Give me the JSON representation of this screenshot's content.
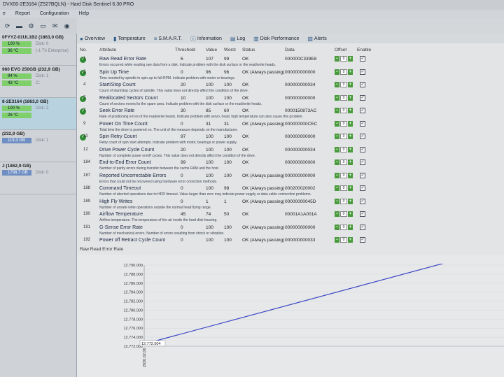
{
  "window": {
    "title": "DVX00-2E3164 (Z527BQLN) - Hard Disk Sentinel 6.30 PRO"
  },
  "menu": [
    "e",
    "Report",
    "Configuration",
    "Help"
  ],
  "toolbar": {
    "icons": [
      "refresh-icon",
      "disk-icon",
      "disk-settings-icon",
      "disk-info-icon",
      "email-icon",
      "camera-icon",
      "tools-icon",
      "report-icon",
      "print-icon",
      "stop-icon",
      "shutdown-icon",
      "help-icon"
    ]
  },
  "sidebar": {
    "disks": [
      {
        "name": "0FYYZ-01UL1B2 (1863,0 GB)",
        "health": "100 %",
        "health_note": "Disk: 0",
        "temp": "36 °C",
        "temp_note": "(-1 Th Enterprise)"
      },
      {
        "name": "960 EVO 250GB (232,9 GB)",
        "health": "94 %",
        "health_note": "Disk: 1",
        "temp": "43 °C",
        "temp_note": "C:"
      },
      {
        "name": "8-2E3164 (1863,0 GB)",
        "health": "100 %",
        "health_note": "Disk: 2",
        "temp": "26 °C",
        "temp_note": ""
      },
      {
        "name": "(232,9 GB)",
        "health": "119,3 GB",
        "health_note": "Disk: 1",
        "temp": "",
        "temp_note": ""
      },
      {
        "name": "J (1862,9 GB)",
        "health": "1798,7 GB",
        "health_note": "Disk: 0",
        "temp": "",
        "temp_note": ""
      }
    ]
  },
  "tabs": [
    {
      "label": "Overview",
      "icon": "overview-icon"
    },
    {
      "label": "Temperature",
      "icon": "thermometer-icon"
    },
    {
      "label": "S.M.A.R.T.",
      "icon": "smart-icon"
    },
    {
      "label": "Information",
      "icon": "info-icon"
    },
    {
      "label": "Log",
      "icon": "log-icon"
    },
    {
      "label": "Disk Performance",
      "icon": "performance-icon"
    },
    {
      "label": "Alerts",
      "icon": "alerts-icon"
    }
  ],
  "table": {
    "headers": [
      "No.",
      "Attribute",
      "Threshold",
      "Value",
      "Worst",
      "Status",
      "Data",
      "Offset",
      "Enable"
    ],
    "rows": [
      {
        "no": "1",
        "attribute": "Raw Read Error Rate",
        "desc": "Errors occurred while reading raw data from a disk. Indicate problem with the disk surface or the read/write heads.",
        "threshold": "6",
        "value": "107",
        "worst": "99",
        "status": "OK",
        "data": "000000C339E8",
        "dot": true
      },
      {
        "no": "3",
        "attribute": "Spin Up Time",
        "desc": "Time needed by spindle to spin-up to full RPM. Indicate problem with motor or bearings.",
        "threshold": "0",
        "value": "96",
        "worst": "96",
        "status": "OK (Always passing)",
        "data": "000000000000",
        "dot": true
      },
      {
        "no": "4",
        "attribute": "Start/Stop Count",
        "desc": "Count of start/stop cycles of spindle. This value does not directly affect the condition of the drive.",
        "threshold": "20",
        "value": "100",
        "worst": "100",
        "status": "OK",
        "data": "000000000034",
        "dot": false
      },
      {
        "no": "5",
        "attribute": "Reallocated Sectors Count",
        "desc": "Count of sectors moved to the spare area. Indicate problem with the disk surface or the read/write heads.",
        "threshold": "10",
        "value": "100",
        "worst": "100",
        "status": "OK",
        "data": "000000000000",
        "dot": true
      },
      {
        "no": "7",
        "attribute": "Seek Error Rate",
        "desc": "Rate of positioning errors of the read/write heads. Indicate problem with servo, head, high temperature can also cause this problem.",
        "threshold": "30",
        "value": "85",
        "worst": "60",
        "status": "OK",
        "data": "0000150873AC",
        "dot": true
      },
      {
        "no": "9",
        "attribute": "Power On Time Count",
        "desc": "Total time the drive is powered on. The unit of the measure depends on the manufacturer.",
        "threshold": "0",
        "value": "31",
        "worst": "31",
        "status": "OK (Always passing)",
        "data": "000000000CEC",
        "dot": false
      },
      {
        "no": "10",
        "attribute": "Spin Retry Count",
        "desc": "Retry count of spin start attempts. Indicate problem with motor, bearings or power supply.",
        "threshold": "97",
        "value": "100",
        "worst": "100",
        "status": "OK",
        "data": "000000000000",
        "dot": true
      },
      {
        "no": "12",
        "attribute": "Drive Power Cycle Count",
        "desc": "Number of complete power on/off cycles. This value does not directly affect the condition of the drive.",
        "threshold": "20",
        "value": "100",
        "worst": "100",
        "status": "OK",
        "data": "000000000034",
        "dot": false
      },
      {
        "no": "184",
        "attribute": "End-to-End Error Count",
        "desc": "Number of parity errors during transfer between the cache RAM and the host.",
        "threshold": "99",
        "value": "100",
        "worst": "100",
        "status": "OK",
        "data": "000000000000",
        "dot": false
      },
      {
        "no": "187",
        "attribute": "Reported Uncorrectable Errors",
        "desc": "Errors that could not be recovered using hardware error correction methods.",
        "threshold": "0",
        "value": "100",
        "worst": "100",
        "status": "OK (Always passing)",
        "data": "000000000000",
        "dot": false
      },
      {
        "no": "188",
        "attribute": "Command Timeout",
        "desc": "Number of aborted operations due to HDD timeout. Value larger than zero may indicate power supply or data cable connection problems.",
        "threshold": "0",
        "value": "100",
        "worst": "98",
        "status": "OK (Always passing)",
        "data": "000200020002",
        "dot": false
      },
      {
        "no": "189",
        "attribute": "High Fly Writes",
        "desc": "Number of unsafe write operations outside the normal head flying range.",
        "threshold": "0",
        "value": "1",
        "worst": "1",
        "status": "OK (Always passing)",
        "data": "00000000045D",
        "dot": false
      },
      {
        "no": "190",
        "attribute": "Airflow Temperature",
        "desc": "Airflow temperature. The temperature of the air inside the hard disk housing.",
        "threshold": "45",
        "value": "74",
        "worst": "50",
        "status": "OK",
        "data": "00001A1A001A",
        "dot": false
      },
      {
        "no": "191",
        "attribute": "G-Sense Error Rate",
        "desc": "Number of mechanical errors. Number of errors resulting from shock or vibration.",
        "threshold": "0",
        "value": "100",
        "worst": "100",
        "status": "OK (Always passing)",
        "data": "000000000000",
        "dot": false
      },
      {
        "no": "192",
        "attribute": "Power off Retract Cycle Count",
        "desc": "",
        "threshold": "0",
        "value": "100",
        "worst": "100",
        "status": "OK (Always passing)",
        "data": "000000000033",
        "dot": false
      }
    ],
    "offset_value": "0"
  },
  "graph": {
    "label": "Raw Read Error Rate",
    "tooltip": "12.772.504",
    "x_date": "2020.02.06"
  },
  "chart_data": {
    "type": "line",
    "title": "Raw Read Error Rate",
    "y_ticks": [
      "12.790.000",
      "12.788.000",
      "12.786.000",
      "12.784.000",
      "12.782.000",
      "12.780.000",
      "12.778.000",
      "12.776.000",
      "12.774.000",
      "12.772.000"
    ],
    "ylim": [
      12772000,
      12790000
    ],
    "x": [
      "2020.02.06",
      ""
    ],
    "series": [
      {
        "values": [
          12772504,
          12794000
        ]
      }
    ],
    "colors": {
      "line": "#3b44c4"
    }
  }
}
